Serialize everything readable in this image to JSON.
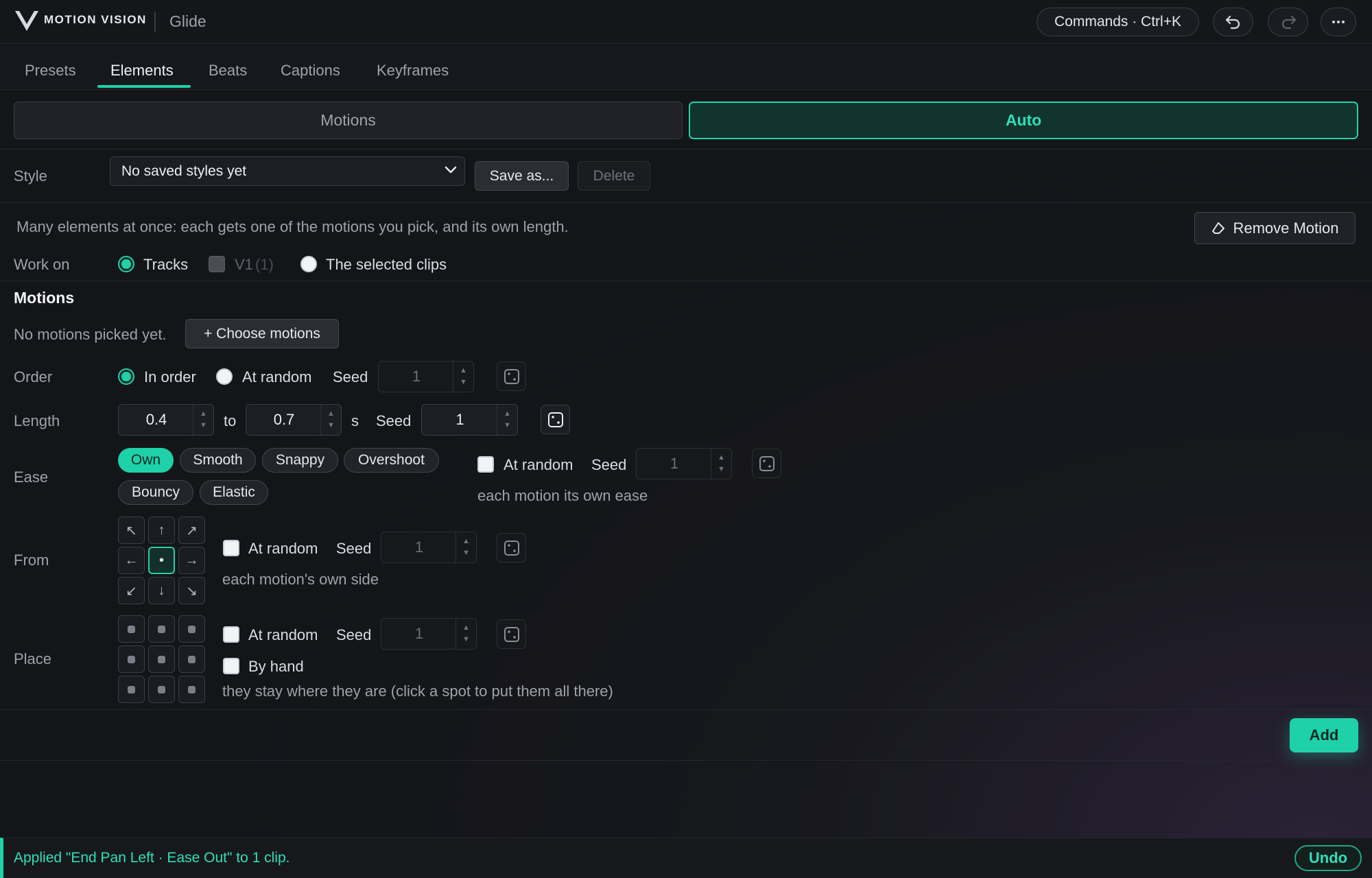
{
  "brand": {
    "logo_text": "MOTION VISION",
    "app_name": "Glide"
  },
  "header": {
    "commands_label": "Commands · Ctrl+K",
    "undo_icon": "undo-icon",
    "redo_icon": "redo-icon",
    "more_icon": "more-icon"
  },
  "tabs": [
    "Presets",
    "Elements",
    "Beats",
    "Captions",
    "Keyframes"
  ],
  "active_tab": "Elements",
  "mode": {
    "motions_label": "Motions",
    "auto_label": "Auto",
    "selected": "Auto"
  },
  "style": {
    "label": "Style",
    "selected_value": "No saved styles yet",
    "save_label": "Save as...",
    "delete_label": "Delete"
  },
  "description": "Many elements at once: each gets one of the motions you pick, and its own length.",
  "remove_motion_label": "Remove Motion",
  "work_on": {
    "label": "Work on",
    "tracks_label": "Tracks",
    "v1_label": "V1",
    "v1_count": "(1)",
    "selected_clips_label": "The selected clips",
    "selected": "Tracks"
  },
  "motions": {
    "heading": "Motions",
    "empty_text": "No motions picked yet.",
    "choose_label": "+ Choose motions"
  },
  "order": {
    "label": "Order",
    "in_order_label": "In order",
    "at_random_label": "At random",
    "seed_label": "Seed",
    "seed_value": "1",
    "selected": "In order"
  },
  "length": {
    "label": "Length",
    "min_value": "0.4",
    "to_label": "to",
    "max_value": "0.7",
    "unit": "s",
    "seed_label": "Seed",
    "seed_value": "1"
  },
  "ease": {
    "label": "Ease",
    "options": [
      "Own",
      "Smooth",
      "Snappy",
      "Overshoot",
      "Bouncy",
      "Elastic"
    ],
    "selected": "Own",
    "at_random_label": "At random",
    "seed_label": "Seed",
    "seed_value": "1",
    "hint": "each motion its own ease"
  },
  "from": {
    "label": "From",
    "arrows": [
      "↖",
      "↑",
      "↗",
      "←",
      "•",
      "→",
      "↙",
      "↓",
      "↘"
    ],
    "selected_index": 4,
    "at_random_label": "At random",
    "seed_label": "Seed",
    "seed_value": "1",
    "hint": "each motion's own side"
  },
  "place": {
    "label": "Place",
    "at_random_label": "At random",
    "seed_label": "Seed",
    "seed_value": "1",
    "by_hand_label": "By hand",
    "hint": "they stay where they are (click a spot to put them all there)"
  },
  "add_label": "Add",
  "status": {
    "message": "Applied \"End Pan Left · Ease Out\" to 1 clip.",
    "undo_label": "Undo"
  },
  "colors": {
    "accent": "#1fd1a9",
    "background": "#141519"
  }
}
